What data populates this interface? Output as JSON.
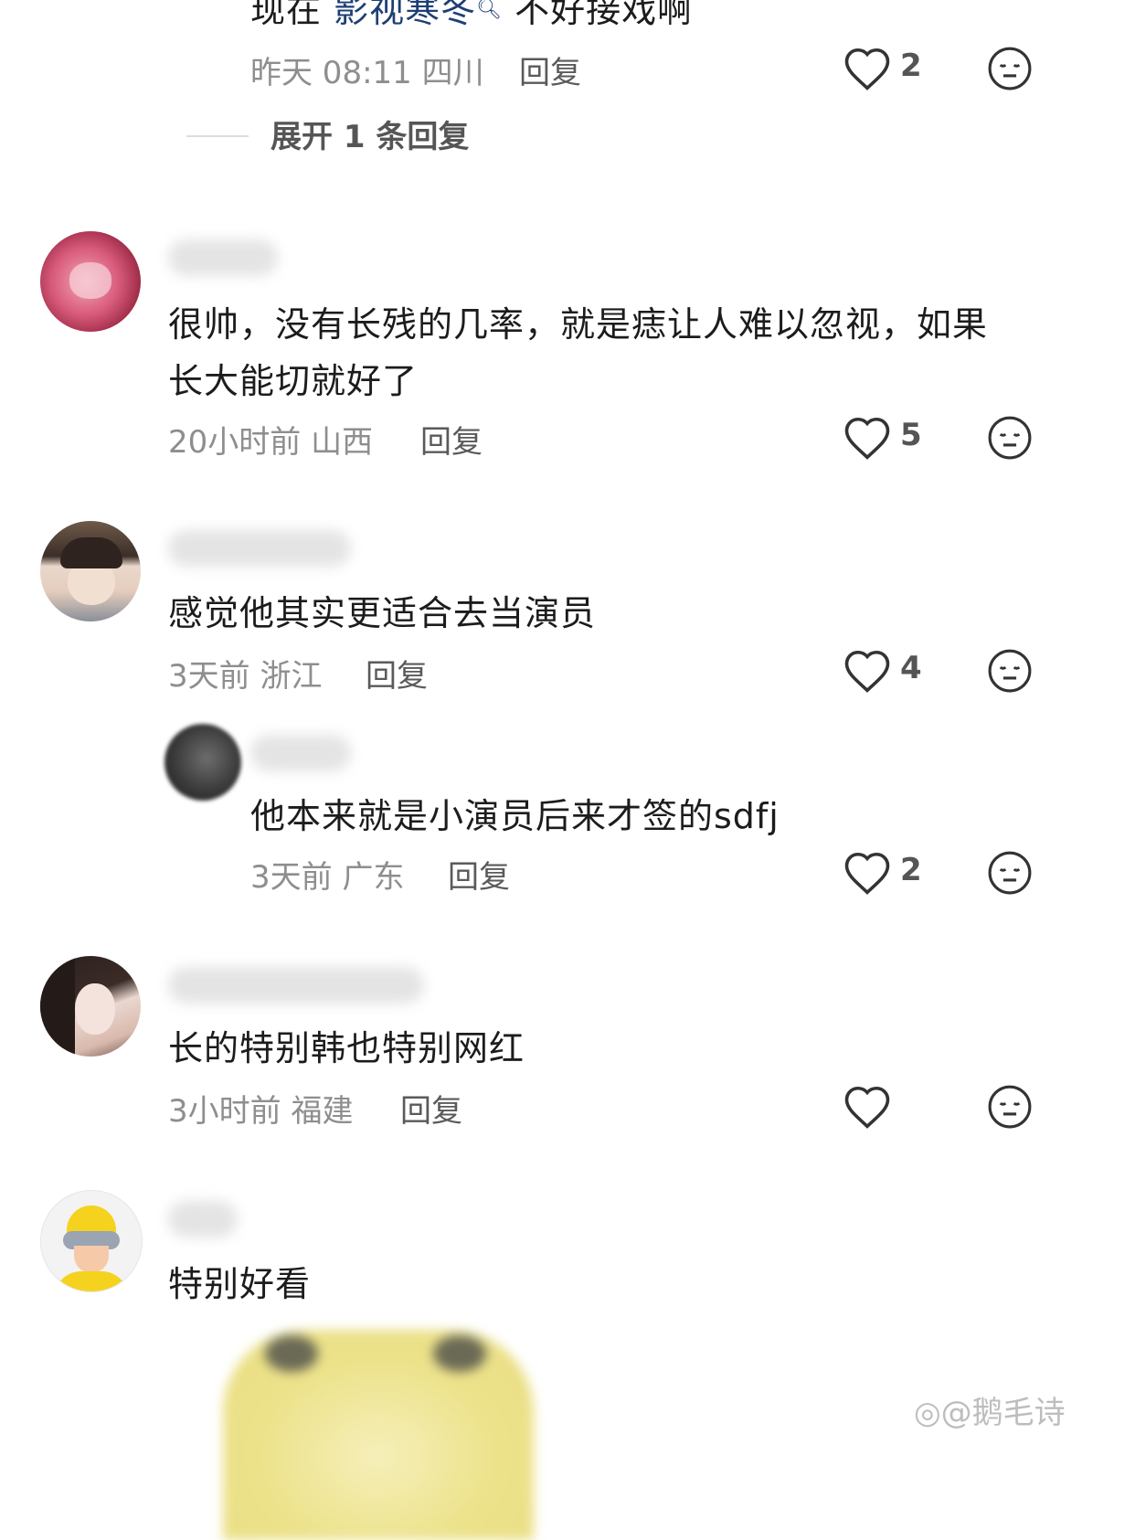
{
  "top_comment": {
    "text_prefix": "现在 ",
    "text_highlight": "影视寒冬",
    "text_suffix": " 不好接戏啊",
    "time": "昨天 08:11",
    "location": "四川",
    "reply_label": "回复",
    "likes": "2",
    "expand_label": "展开 1 条回复"
  },
  "comments": [
    {
      "lines": [
        "很帅，没有长残的几率，就是痣让人难以忽视，如果",
        "长大能切就好了"
      ],
      "time": "20小时前",
      "location": "山西",
      "reply_label": "回复",
      "likes": "5"
    },
    {
      "lines": [
        "感觉他其实更适合去当演员"
      ],
      "time": "3天前",
      "location": "浙江",
      "reply_label": "回复",
      "likes": "4",
      "sub_reply": {
        "text": "他本来就是小演员后来才签的sdfj",
        "time": "3天前",
        "location": "广东",
        "reply_label": "回复",
        "likes": "2"
      }
    },
    {
      "lines": [
        "长的特别韩也特别网红"
      ],
      "time": "3小时前",
      "location": "福建",
      "reply_label": "回复",
      "likes": ""
    },
    {
      "lines": [
        "特别好看"
      ]
    }
  ],
  "watermark": "@鹅毛诗",
  "icons": {
    "like": "heart-outline-icon",
    "dislike": "neutral-face-icon",
    "search_hint": "search-icon",
    "watermark": "weibo-logo-icon"
  },
  "colors": {
    "highlight": "#1e3f74",
    "meta": "#8e8e8e",
    "icon": "#333333"
  }
}
